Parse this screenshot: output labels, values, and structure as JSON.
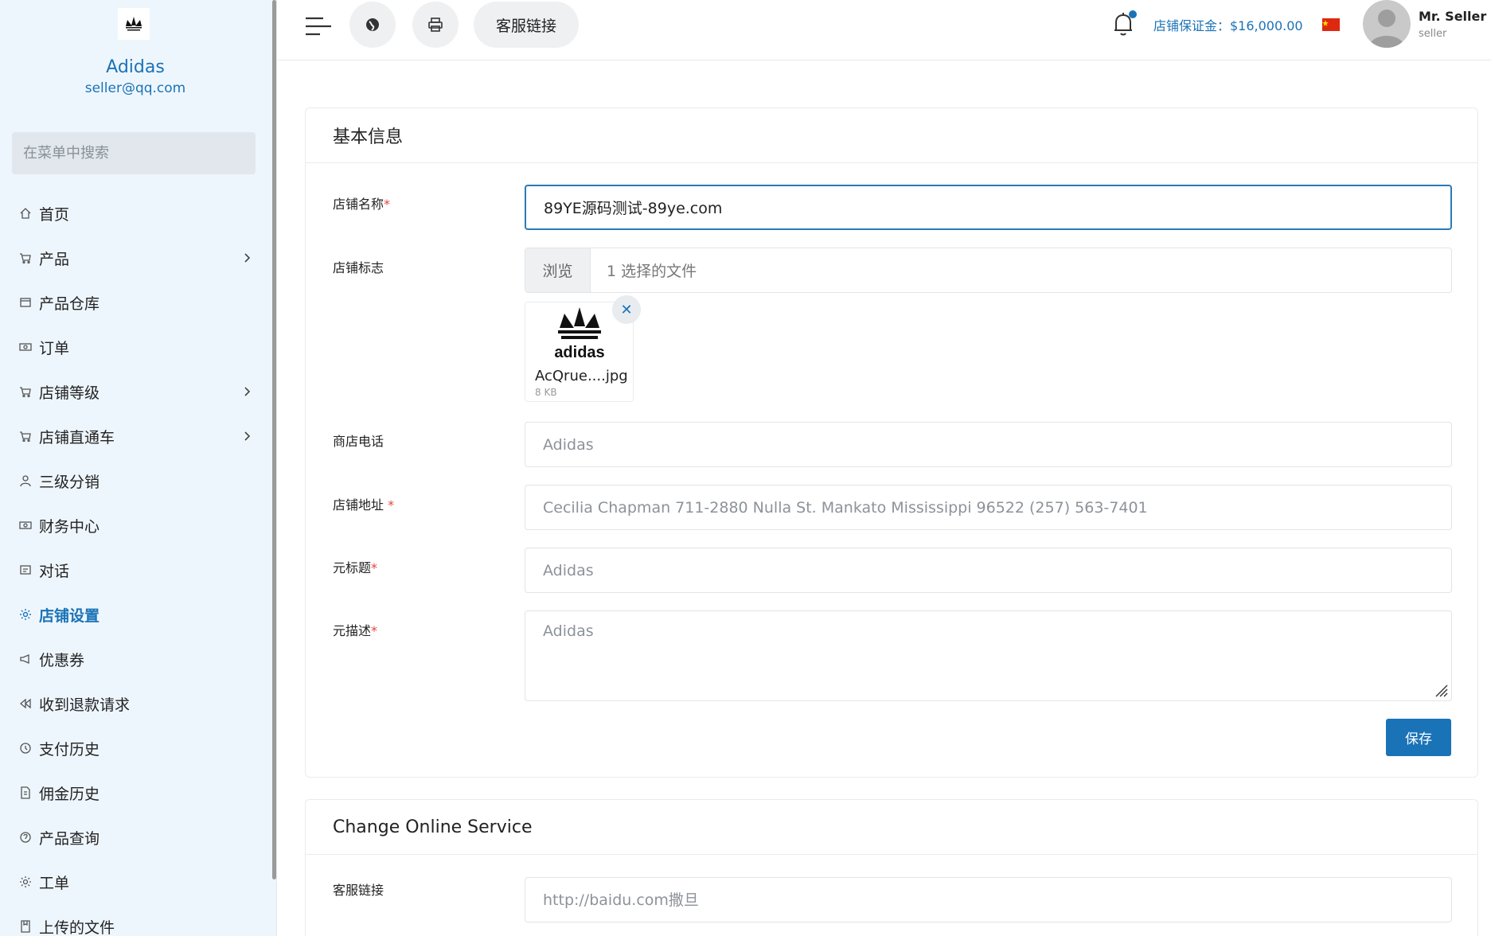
{
  "sidebar": {
    "brand_name": "Adidas",
    "brand_email": "seller@qq.com",
    "search_placeholder": "在菜单中搜索",
    "items": [
      {
        "label": "首页",
        "icon": "home-icon",
        "has_children": false
      },
      {
        "label": "产品",
        "icon": "cart-icon",
        "has_children": true
      },
      {
        "label": "产品仓库",
        "icon": "warehouse-icon",
        "has_children": false
      },
      {
        "label": "订单",
        "icon": "money-icon",
        "has_children": false
      },
      {
        "label": "店铺等级",
        "icon": "cart-icon",
        "has_children": true
      },
      {
        "label": "店铺直通车",
        "icon": "cart-icon",
        "has_children": true
      },
      {
        "label": "三级分销",
        "icon": "user-icon",
        "has_children": false
      },
      {
        "label": "财务中心",
        "icon": "money-icon",
        "has_children": false
      },
      {
        "label": "对话",
        "icon": "chat-icon",
        "has_children": false
      },
      {
        "label": "店铺设置",
        "icon": "gear-icon",
        "has_children": false,
        "active": true
      },
      {
        "label": "优惠券",
        "icon": "megaphone-icon",
        "has_children": false
      },
      {
        "label": "收到退款请求",
        "icon": "backward-icon",
        "has_children": false
      },
      {
        "label": "支付历史",
        "icon": "history-icon",
        "has_children": false
      },
      {
        "label": "佣金历史",
        "icon": "file-icon",
        "has_children": false
      },
      {
        "label": "产品查询",
        "icon": "question-icon",
        "has_children": false
      },
      {
        "label": "工单",
        "icon": "gear-icon",
        "has_children": false
      },
      {
        "label": "上传的文件",
        "icon": "folder-icon",
        "has_children": false
      }
    ]
  },
  "header": {
    "service_link_label": "客服链接",
    "deposit_text": "店铺保证金：$16,000.00",
    "user_name": "Mr. Seller",
    "user_role": "seller"
  },
  "basic_info": {
    "title": "基本信息",
    "shop_name_label": "店铺名称",
    "shop_name_value": "89YE源码测试-89ye.com",
    "logo_label": "店铺标志",
    "browse_label": "浏览",
    "file_status": "1 选择的文件",
    "thumb_name": "AcQrue....jpg",
    "thumb_size": "8 KB",
    "thumb_logo_text": "adidas",
    "phone_label": "商店电话",
    "phone_placeholder": "Adidas",
    "address_label": "店铺地址",
    "address_placeholder": "Cecilia Chapman 711-2880 Nulla St. Mankato Mississippi 96522 (257) 563-7401",
    "meta_title_label": "元标题",
    "meta_title_placeholder": "Adidas",
    "meta_desc_label": "元描述",
    "meta_desc_placeholder": "Adidas",
    "save_label": "保存",
    "required_mark": "*"
  },
  "online_service": {
    "title": "Change Online Service",
    "link_label": "客服链接",
    "link_placeholder": "http://baidu.com撒旦"
  },
  "colors": {
    "accent": "#1a73b7",
    "sidebar_bg": "#eef6fd",
    "required": "#e2453c"
  }
}
